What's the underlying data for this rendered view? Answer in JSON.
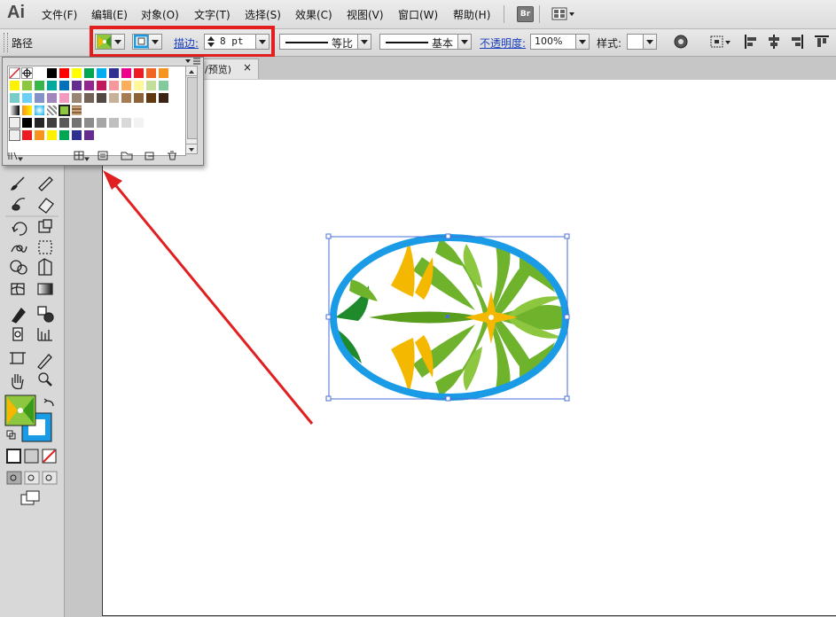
{
  "app": {
    "logo": "Ai"
  },
  "menu": [
    {
      "label": "文件(F)"
    },
    {
      "label": "编辑(E)"
    },
    {
      "label": "对象(O)"
    },
    {
      "label": "文字(T)"
    },
    {
      "label": "选择(S)"
    },
    {
      "label": "效果(C)"
    },
    {
      "label": "视图(V)"
    },
    {
      "label": "窗口(W)"
    },
    {
      "label": "帮助(H)"
    }
  ],
  "bridge_button": "Br",
  "control": {
    "selection_type": "路径",
    "stroke_label": "描边:",
    "stroke_weight": "8 pt",
    "profile_label": "等比",
    "brush_label": "基本",
    "opacity_label": "不透明度:",
    "opacity_value": "100%",
    "style_label": "样式:"
  },
  "document": {
    "tab_label": "/预览)"
  },
  "colors": {
    "highlight": "#e21e1e",
    "ellipse_stroke": "#1a9be6",
    "selection": "#4a6fd8",
    "arrow": "#e02020",
    "fill_green": "#6fb22c",
    "fill_yellow": "#f5b800"
  },
  "swatches": {
    "rows": [
      [
        "none",
        "registration",
        "#ffffff",
        "#000000",
        "#ff0000",
        "#ffff00",
        "#00a651",
        "#00aeef",
        "#2e3192",
        "#ec008c",
        "#ed1c24",
        "#f26522",
        "#f7941d"
      ],
      [
        "#fff200",
        "#8dc63f",
        "#39b54a",
        "#00a99d",
        "#0072bc",
        "#662d91",
        "#92278f",
        "#c2185b",
        "#f5989d",
        "#fbaf5d",
        "#fff79a",
        "#c4df9b",
        "#82ca9c"
      ],
      [
        "#7accc8",
        "#6dcff6",
        "#8393ca",
        "#a187be",
        "#f49ac1",
        "#998675",
        "#736357",
        "#534741",
        "#c7b299",
        "#a67c52",
        "#8c6239",
        "#603913",
        "#3c2415"
      ],
      [
        "grad1",
        "grad2",
        "grad3",
        "pattern1",
        "pattern2",
        "pattern3"
      ],
      [
        "#000000",
        "#262626",
        "#404040",
        "#595959",
        "#737373",
        "#8c8c8c",
        "#a6a6a6",
        "#bfbfbf",
        "#d9d9d9",
        "#f2f2f2"
      ],
      [
        "#ed1c24",
        "#f7941d",
        "#fff200",
        "#00a651",
        "#2e3192",
        "#662d91"
      ]
    ]
  }
}
